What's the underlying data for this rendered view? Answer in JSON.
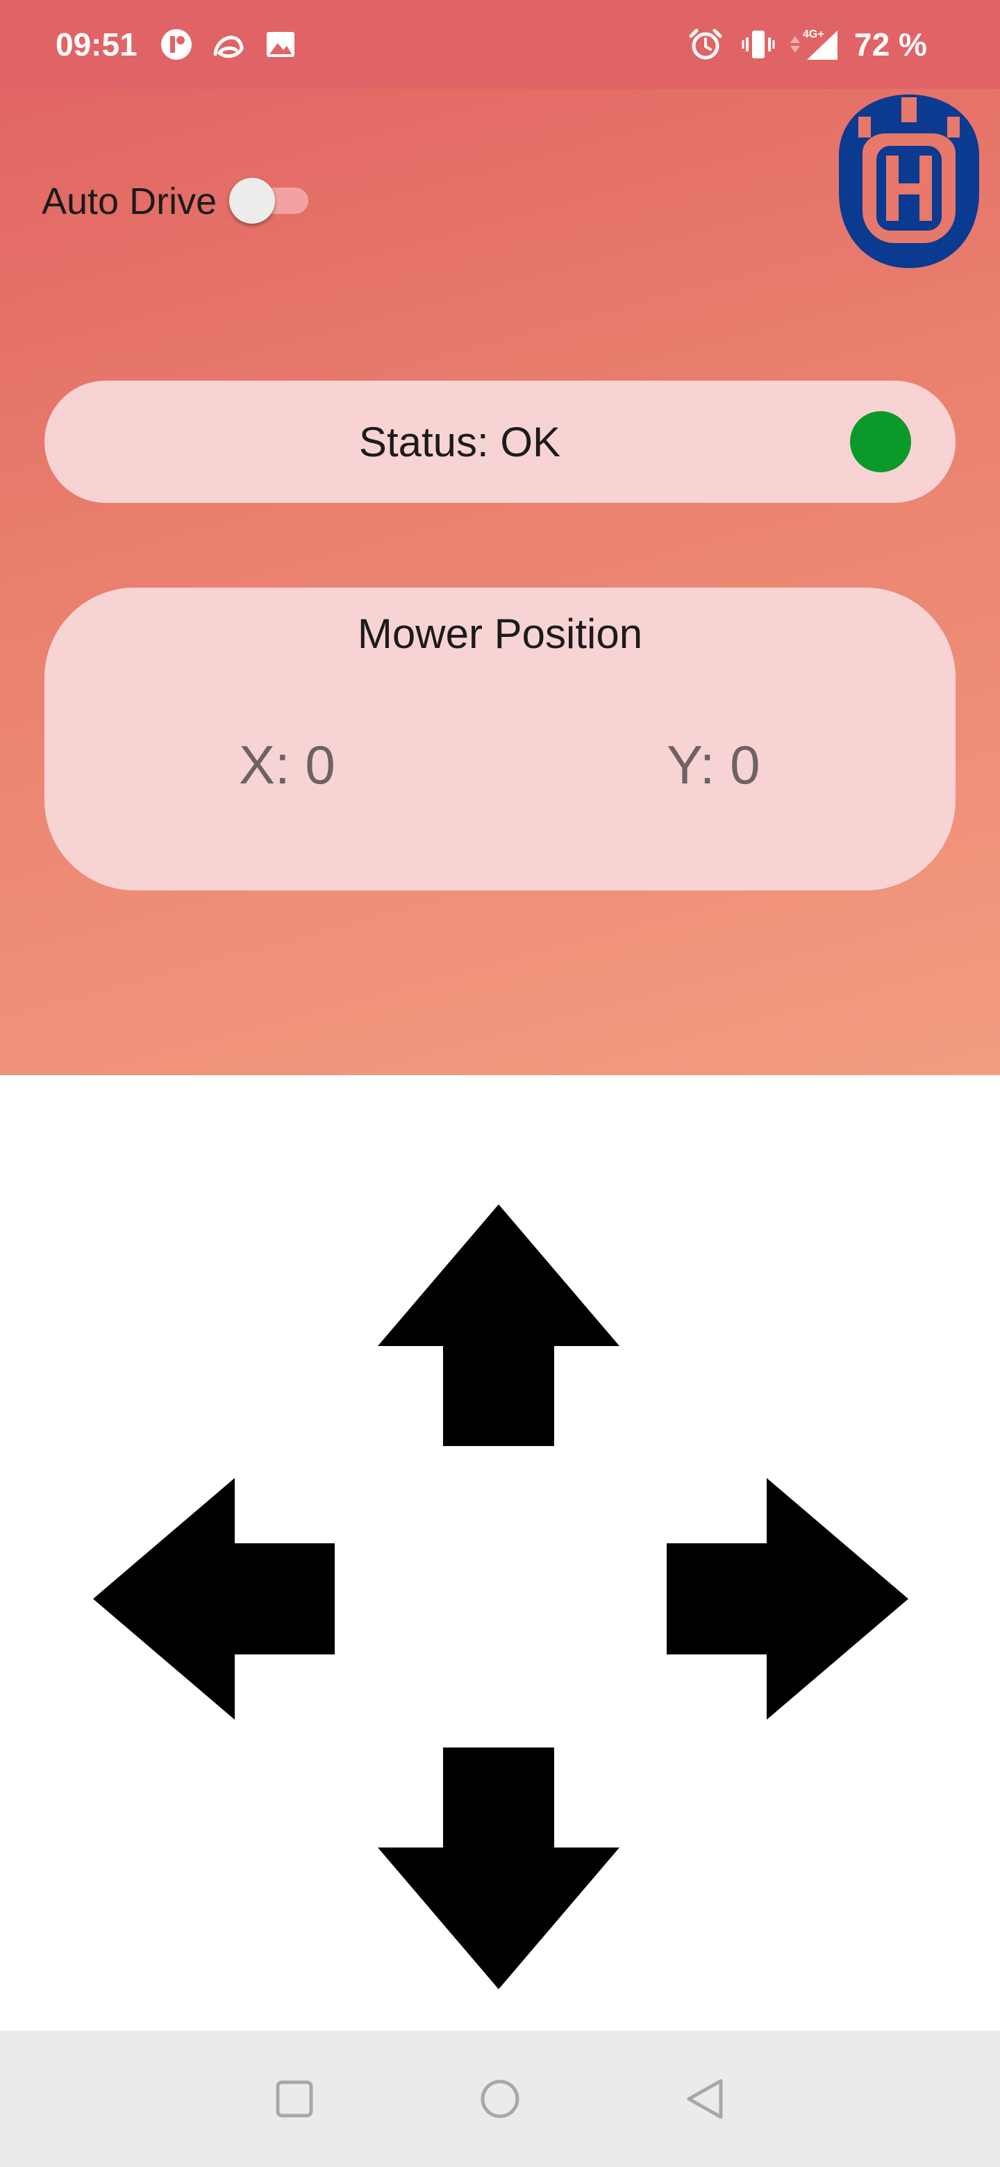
{
  "status_bar": {
    "time": "09:51",
    "battery": "72 %",
    "network_label": "4G+",
    "left_icons": [
      "notification-app-icon",
      "edge-app-icon",
      "gallery-icon"
    ],
    "right_icons": [
      "alarm-icon",
      "vibrate-icon",
      "data-arrows-icon",
      "signal-icon"
    ]
  },
  "header": {
    "auto_drive_label": "Auto Drive",
    "auto_drive_on": false,
    "logo_icon": "husqvarna-crown-h-logo",
    "logo_color": "#0b3a91"
  },
  "status_card": {
    "text": "Status: OK",
    "indicator_color": "#0b9a2a"
  },
  "position_card": {
    "title": "Mower Position",
    "x_text": "X: 0",
    "y_text": "Y: 0"
  },
  "controls": {
    "icons": [
      "arrow-up-icon",
      "arrow-left-icon",
      "arrow-right-icon",
      "arrow-down-icon"
    ]
  },
  "colors": {
    "gradient_top": "#e06162",
    "gradient_bottom": "#f39c80",
    "card_background": "#f8d3d4",
    "nav_background": "#ebebeb"
  },
  "nav_bar": {
    "icons": [
      "recents-icon",
      "home-icon",
      "back-icon"
    ]
  }
}
